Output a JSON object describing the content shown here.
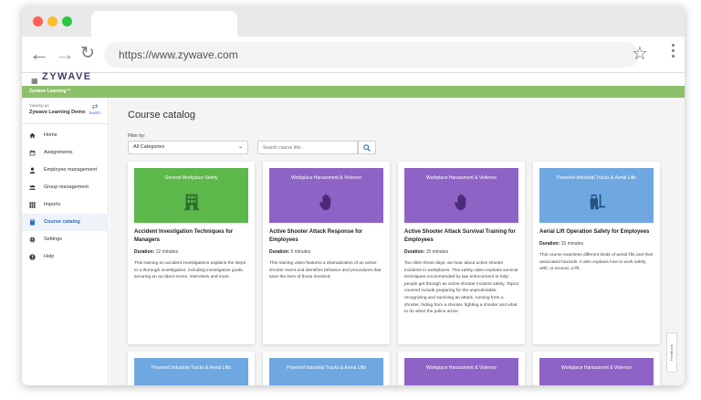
{
  "browser": {
    "url": "https://www.zywave.com",
    "colors": {
      "close": "#ff5f57",
      "minimize": "#febc2e",
      "maximize": "#28c840"
    }
  },
  "app": {
    "logo": "ZYWAVE",
    "product_bar": "Zywave Learning™",
    "viewing_as_label": "Viewing as",
    "viewing_as_name": "Zywave Learning Demo",
    "switch_label": "Switch",
    "accent": "#8dc06b"
  },
  "sidebar": {
    "items": [
      {
        "label": "Home",
        "icon": "home-icon"
      },
      {
        "label": "Assignments",
        "icon": "calendar-icon"
      },
      {
        "label": "Employee management",
        "icon": "person-icon"
      },
      {
        "label": "Group management",
        "icon": "group-icon"
      },
      {
        "label": "Imports",
        "icon": "grid-icon"
      },
      {
        "label": "Course catalog",
        "icon": "book-icon",
        "active": true
      },
      {
        "label": "Settings",
        "icon": "gear-icon"
      },
      {
        "label": "Help",
        "icon": "help-icon"
      }
    ]
  },
  "catalog": {
    "title": "Course catalog",
    "filter_label": "Filter by:",
    "filter_value": "All Categories",
    "search_placeholder": "Search course title...",
    "cards": [
      {
        "category": "General Workplace Safety",
        "color": "#5cb84a",
        "icon": "building-icon",
        "title": "Accident Investigation Techniques for Managers",
        "duration_label": "Duration:",
        "duration": "12 minutes",
        "description": "This training on accident investigations explains the steps to a thorough investigation, including investigative goals, securing an accident scene, interviews and more."
      },
      {
        "category": "Workplace Harassment & Violence",
        "color": "#8e63c6",
        "icon": "hand-icon",
        "title": "Active Shooter Attack Response for Employees",
        "duration_label": "Duration:",
        "duration": "6 minutes",
        "description": "This training video features a dramatization of an active shooter event and identifies behavior and procedures that save the lives of those involved."
      },
      {
        "category": "Workplace Harassment & Violence",
        "color": "#8e63c6",
        "icon": "hand-icon",
        "title": "Active Shooter Attack Survival Training for Employees",
        "duration_label": "Duration:",
        "duration": "15 minutes",
        "description": "Too often these days, we hear about active shooter incidents in workplaces. This safety video explains survival techniques recommended by law enforcement to help people get through an active shooter incident safely. Topics covered include preparing for the unpredictable, recognizing and surviving an attack, running from a shooter, hiding from a shooter, fighting a shooter and what to do when the police arrive."
      },
      {
        "category": "Powered Industrial Trucks & Aerial Lifts",
        "color": "#6fa8e0",
        "icon": "forklift-icon",
        "title": "Aerial Lift Operation Safety for Employees",
        "duration_label": "Duration:",
        "duration": "15 minutes",
        "description": "This course examines different kinds of aerial lifts and their associated hazards. It also explains how to work safely with, or around, a lift."
      },
      {
        "category": "Powered Industrial Trucks & Aerial Lifts",
        "color": "#6fa8e0"
      },
      {
        "category": "Powered Industrial Trucks & Aerial Lifts",
        "color": "#6fa8e0"
      },
      {
        "category": "Workplace Harassment & Violence",
        "color": "#8e63c6"
      },
      {
        "category": "Workplace Harassment & Violence",
        "color": "#8e63c6"
      }
    ]
  },
  "feedback_label": "Feedback"
}
